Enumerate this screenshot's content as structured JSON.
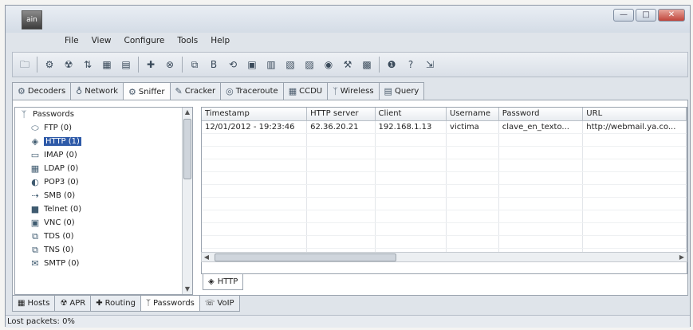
{
  "app": {
    "icon_text": "ain"
  },
  "window": {
    "minimize": "—",
    "maximize": "□",
    "close": "✕"
  },
  "menu": [
    "File",
    "View",
    "Configure",
    "Tools",
    "Help"
  ],
  "toolbar": [
    {
      "icon": "open-icon",
      "glyph": "🗀"
    },
    {
      "icon": "start-sniffer-icon",
      "glyph": "⚙"
    },
    {
      "icon": "apr-icon",
      "glyph": "☢"
    },
    {
      "icon": "ntlm-auth-icon",
      "glyph": "⇅"
    },
    {
      "icon": "ntlm-reset-icon",
      "glyph": "▦"
    },
    {
      "icon": "ntlm-hash-icon",
      "glyph": "▤"
    },
    {
      "icon": "add-icon",
      "glyph": "✚"
    },
    {
      "icon": "delete-icon",
      "glyph": "⊗"
    },
    {
      "icon": "routing-icon",
      "glyph": "⧉"
    },
    {
      "icon": "base64-icon",
      "glyph": "B"
    },
    {
      "icon": "hash-icon",
      "glyph": "⟲"
    },
    {
      "icon": "cisco-icon",
      "glyph": "▣"
    },
    {
      "icon": "pwd-decoder-icon",
      "glyph": "▥"
    },
    {
      "icon": "vnc-icon",
      "glyph": "▧"
    },
    {
      "icon": "lsa-icon",
      "glyph": "▨"
    },
    {
      "icon": "wireless-icon",
      "glyph": "◉"
    },
    {
      "icon": "settings-icon",
      "glyph": "⚒"
    },
    {
      "icon": "certificate-icon",
      "glyph": "▩"
    },
    {
      "icon": "info-icon",
      "glyph": "❶"
    },
    {
      "icon": "help-icon",
      "glyph": "?"
    },
    {
      "icon": "exit-icon",
      "glyph": "⇲"
    }
  ],
  "tabs": [
    {
      "label": "Decoders",
      "icon": "decoders-icon",
      "glyph": "⚙"
    },
    {
      "label": "Network",
      "icon": "network-icon",
      "glyph": "♁"
    },
    {
      "label": "Sniffer",
      "icon": "sniffer-icon",
      "glyph": "⚙"
    },
    {
      "label": "Cracker",
      "icon": "cracker-icon",
      "glyph": "✎"
    },
    {
      "label": "Traceroute",
      "icon": "traceroute-icon",
      "glyph": "◎"
    },
    {
      "label": "CCDU",
      "icon": "ccdu-icon",
      "glyph": "▦"
    },
    {
      "label": "Wireless",
      "icon": "wireless-tab-icon",
      "glyph": "ᛉ"
    },
    {
      "label": "Query",
      "icon": "query-icon",
      "glyph": "▤"
    }
  ],
  "tree": {
    "root": "Passwords",
    "items": [
      {
        "label": "FTP (0)",
        "icon": "ftp-icon",
        "glyph": "⬭"
      },
      {
        "label": "HTTP (1)",
        "icon": "http-icon",
        "glyph": "◈",
        "selected": true
      },
      {
        "label": "IMAP (0)",
        "icon": "imap-icon",
        "glyph": "▭"
      },
      {
        "label": "LDAP (0)",
        "icon": "ldap-icon",
        "glyph": "▦"
      },
      {
        "label": "POP3 (0)",
        "icon": "pop3-icon",
        "glyph": "◐"
      },
      {
        "label": "SMB (0)",
        "icon": "smb-icon",
        "glyph": "⇢"
      },
      {
        "label": "Telnet (0)",
        "icon": "telnet-icon",
        "glyph": "■"
      },
      {
        "label": "VNC (0)",
        "icon": "vnc-tree-icon",
        "glyph": "▣"
      },
      {
        "label": "TDS (0)",
        "icon": "tds-icon",
        "glyph": "⧉"
      },
      {
        "label": "TNS (0)",
        "icon": "tns-icon",
        "glyph": "⧉"
      },
      {
        "label": "SMTP (0)",
        "icon": "smtp-icon",
        "glyph": "✉"
      }
    ]
  },
  "grid": {
    "columns": [
      "Timestamp",
      "HTTP server",
      "Client",
      "Username",
      "Password",
      "URL"
    ],
    "rows": [
      [
        "12/01/2012 - 19:23:46",
        "62.36.20.21",
        "192.168.1.13",
        "victima",
        "clave_en_texto...",
        "http://webmail.ya.co..."
      ]
    ]
  },
  "subtab": {
    "label": "HTTP"
  },
  "bottom_tabs": [
    {
      "label": "Hosts",
      "icon": "hosts-icon",
      "glyph": "▦"
    },
    {
      "label": "APR",
      "icon": "apr-tab-icon",
      "glyph": "☢"
    },
    {
      "label": "Routing",
      "icon": "routing-tab-icon",
      "glyph": "✚"
    },
    {
      "label": "Passwords",
      "icon": "passwords-icon",
      "glyph": "ᛉ",
      "active": true
    },
    {
      "label": "VoIP",
      "icon": "voip-icon",
      "glyph": "☏"
    }
  ],
  "status": {
    "text": "Lost packets:  0%"
  }
}
